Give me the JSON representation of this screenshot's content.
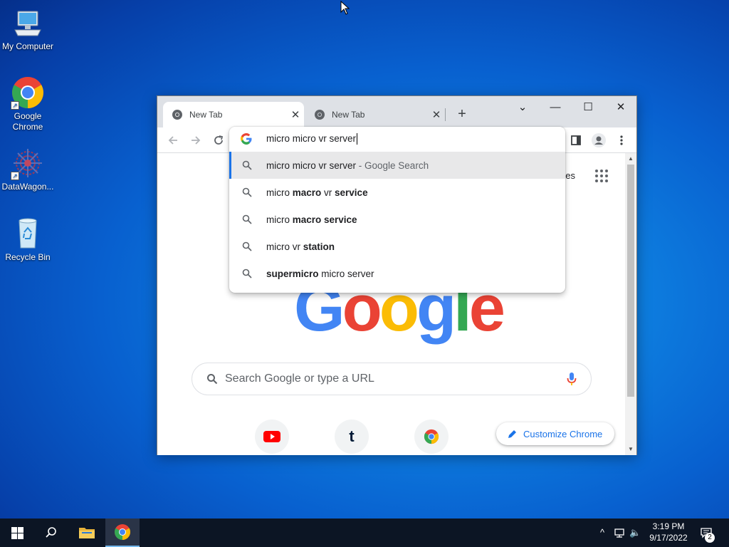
{
  "desktop": {
    "icons": [
      {
        "label": "My Computer",
        "icon": "computer-icon"
      },
      {
        "label": "Google Chrome",
        "icon": "chrome-icon"
      },
      {
        "label": "DataWagon...",
        "icon": "datawagon-icon"
      },
      {
        "label": "Recycle Bin",
        "icon": "recycle-bin-icon"
      }
    ]
  },
  "browser": {
    "tabs": [
      {
        "title": "New Tab",
        "active": true,
        "close": "✕"
      },
      {
        "title": "New Tab",
        "active": false,
        "close": "✕"
      }
    ],
    "new_tab_label": "+",
    "window_controls": {
      "tab_search": "⌄",
      "minimize": "—",
      "maximize": "☐",
      "close": "✕"
    },
    "omnibox": {
      "input_text": "micro micro vr server",
      "suggestions": [
        {
          "text": "micro micro vr server",
          "sep": " - ",
          "source": "Google Search",
          "selected": true
        },
        {
          "prefix": "micro ",
          "bold": "macro",
          "middle": " vr ",
          "bold2": "service"
        },
        {
          "prefix": "micro ",
          "bold": "macro service",
          "middle": "",
          "bold2": ""
        },
        {
          "prefix": "micro vr ",
          "bold": "station",
          "middle": "",
          "bold2": ""
        },
        {
          "prefix": "",
          "bold": "supermicro",
          "middle": " micro server",
          "bold2": ""
        }
      ]
    },
    "ntp": {
      "partial_link": "ges",
      "logo_letters": [
        "G",
        "o",
        "o",
        "g",
        "l",
        "e"
      ],
      "search_placeholder": "Search Google or type a URL",
      "shortcuts": [
        {
          "name": "youtube",
          "icon": "youtube-icon"
        },
        {
          "name": "tumblr",
          "icon": "tumblr-icon",
          "glyph": "t"
        },
        {
          "name": "chrome",
          "icon": "chrome-icon"
        }
      ],
      "customize_label": "Customize Chrome"
    }
  },
  "taskbar": {
    "time": "3:19 PM",
    "date": "9/17/2022",
    "notification_count": "2",
    "tray": {
      "chevron": "^",
      "volume": "🔈"
    }
  },
  "colors": {
    "google_blue": "#4285f4",
    "google_red": "#ea4335",
    "google_yellow": "#fbbc05",
    "google_green": "#34a853",
    "accent": "#1a73e8"
  }
}
